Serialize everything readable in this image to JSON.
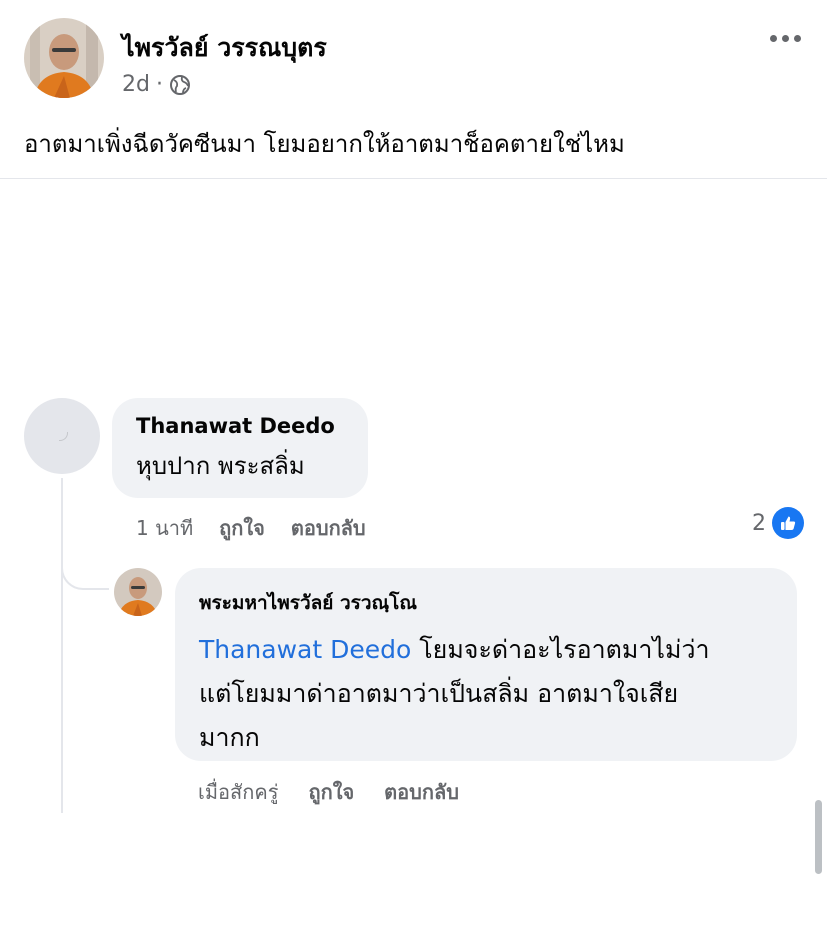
{
  "post": {
    "author": "ไพรวัลย์ วรรณบุตร",
    "time": "2d",
    "separator": "·",
    "privacy_icon": "globe-icon",
    "more_icon": "more-horizontal-icon",
    "text": "อาตมาเพิ่งฉีดวัคซีนมา โยมอยากให้อาตมาช็อคตายใช่ไหม"
  },
  "comments": [
    {
      "author": "Thanawat Deedo",
      "text": "หุบปาก พระสลิ่ม",
      "time": "1 นาที",
      "like_label": "ถูกใจ",
      "reply_label": "ตอบกลับ",
      "reaction_count": "2",
      "reaction_icon": "like-icon"
    }
  ],
  "reply": {
    "author": "พระมหาไพรวัลย์ วรวณฺโณ",
    "mention": "Thanawat Deedo",
    "text_line1": " โยมจะด่าอะไรอาตมาไม่ว่า",
    "text_line2": "แต่โยมมาด่าอาตมาว่าเป็นสลิ่ม อาตมาใจเสีย",
    "text_line3": "มากก",
    "time": "เมื่อสักครู่",
    "like_label": "ถูกใจ",
    "reply_label": "ตอบกลับ"
  },
  "colors": {
    "link": "#216fdb",
    "like_badge": "#1877f2",
    "bubble": "#f0f2f5",
    "robe": "#e07a1f"
  }
}
